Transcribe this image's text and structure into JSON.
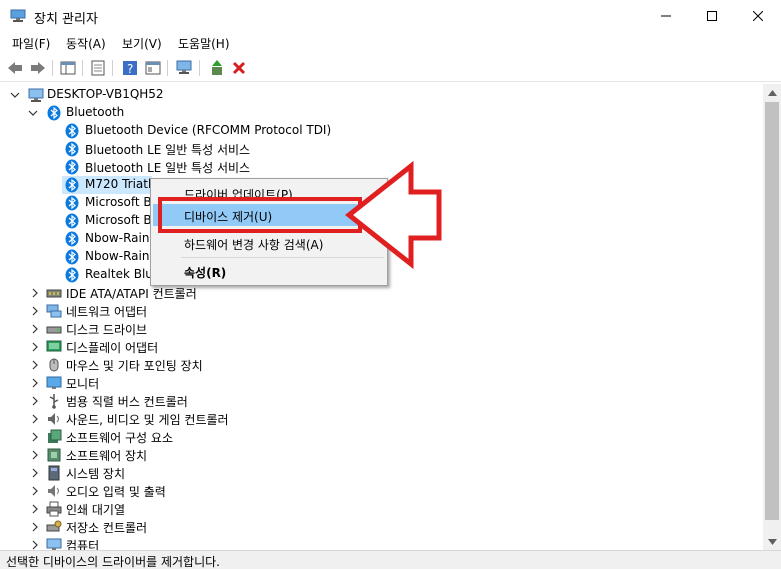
{
  "window": {
    "title": "장치 관리자"
  },
  "menubar": [
    "파일(F)",
    "동작(A)",
    "보기(V)",
    "도움말(H)"
  ],
  "tree": {
    "root": "DESKTOP-VB1QH52",
    "category_open": "Bluetooth",
    "bluetooth_children": [
      "Bluetooth Device (RFCOMM Protocol TDI)",
      "Bluetooth LE 일반 특성 서비스",
      "Bluetooth LE 일반 특성 서비스",
      "M720 Triath",
      "Microsoft B",
      "Microsoft B",
      "Nbow-Rainb",
      "Nbow-Rainb",
      "Realtek Blue"
    ],
    "categories": [
      "IDE ATA/ATAPI 컨트롤러",
      "네트워크 어댑터",
      "디스크 드라이브",
      "디스플레이 어댑터",
      "마우스 및 기타 포인팅 장치",
      "모니터",
      "범용 직렬 버스 컨트롤러",
      "사운드, 비디오 및 게임 컨트롤러",
      "소프트웨어 구성 요소",
      "소프트웨어 장치",
      "시스템 장치",
      "오디오 입력 및 출력",
      "인쇄 대기열",
      "저장소 컨트롤러",
      "컴퓨터"
    ]
  },
  "context_menu": {
    "update": "드라이버 업데이트(P)",
    "uninstall": "디바이스 제거(U)",
    "scan": "하드웨어 변경 사항 검색(A)",
    "properties": "속성(R)"
  },
  "status": "선택한 디바이스의 드라이버를 제거합니다.",
  "colors": {
    "highlight": "#91c9f7",
    "annotation": "#e02020",
    "bluetooth": "#0a7adf"
  }
}
